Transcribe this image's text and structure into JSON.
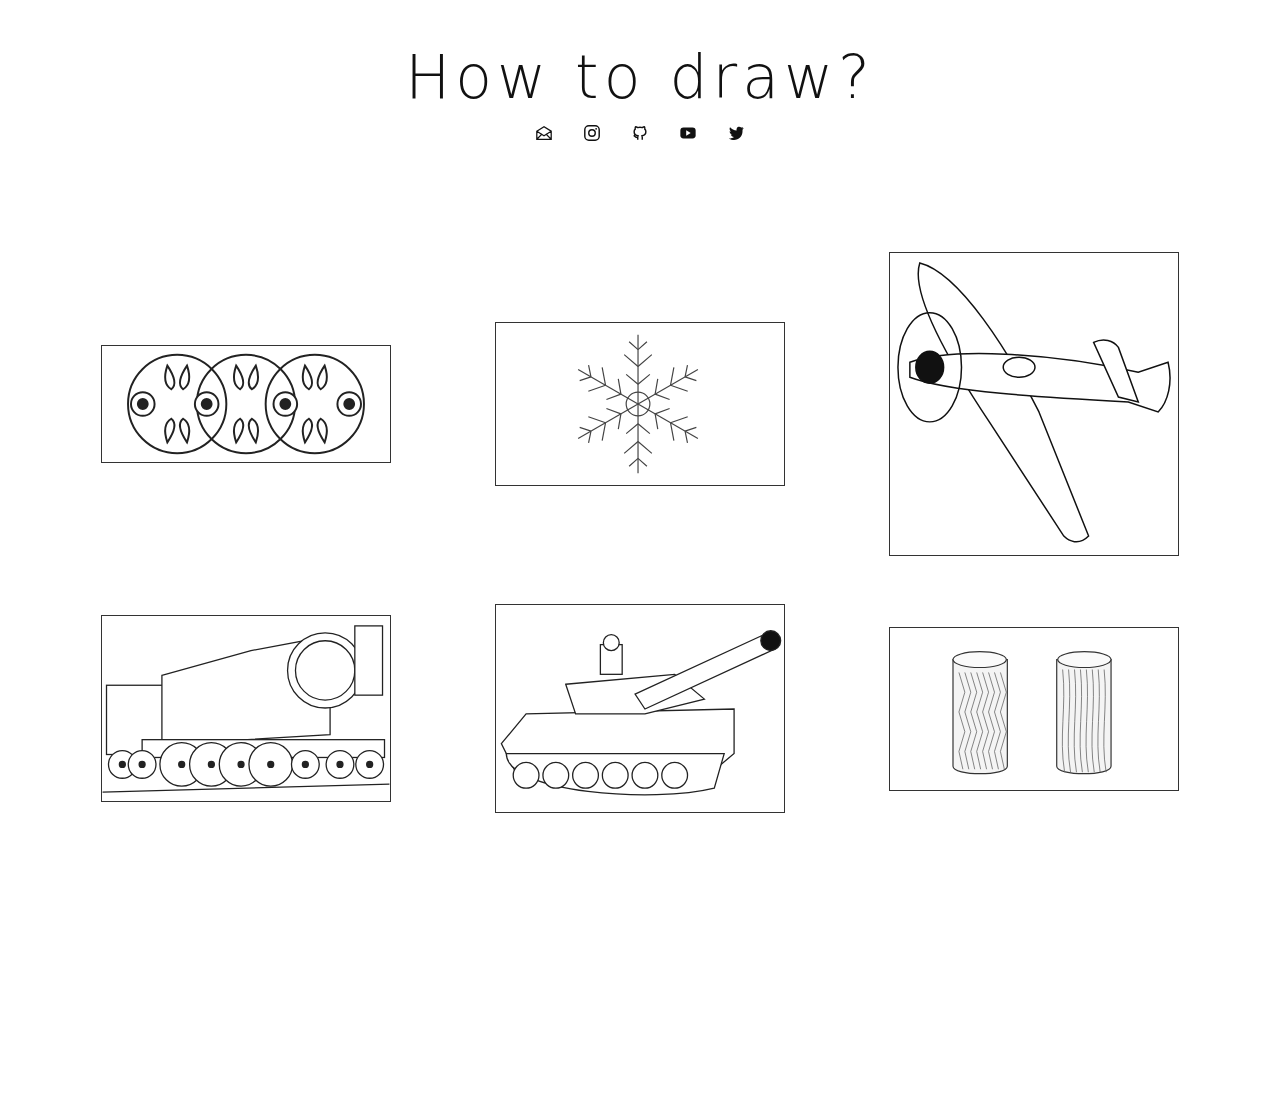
{
  "title": "How to draw?",
  "cards": [
    {
      "kind": "ornament"
    },
    {
      "kind": "snowflake"
    },
    {
      "kind": "airplane"
    },
    {
      "kind": "locomotive"
    },
    {
      "kind": "tank"
    },
    {
      "kind": "logs"
    }
  ]
}
